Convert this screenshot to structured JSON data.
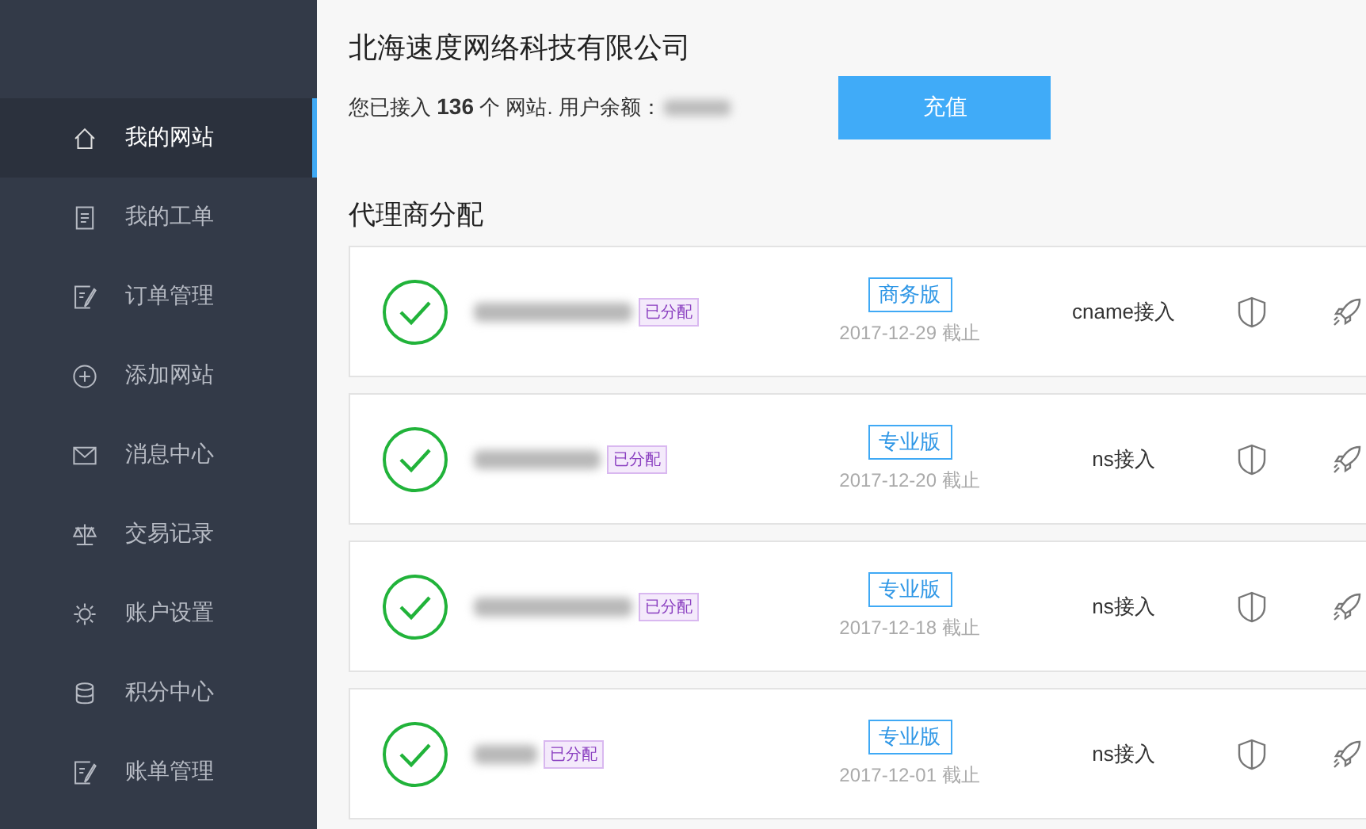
{
  "sidebar": {
    "items": [
      {
        "label": "我的网站",
        "kind": "home",
        "selected": true
      },
      {
        "label": "我的工单",
        "kind": "doc",
        "selected": false
      },
      {
        "label": "订单管理",
        "kind": "edit",
        "selected": false
      },
      {
        "label": "添加网站",
        "kind": "plus",
        "selected": false
      },
      {
        "label": "消息中心",
        "kind": "mail",
        "selected": false
      },
      {
        "label": "交易记录",
        "kind": "scale",
        "selected": false
      },
      {
        "label": "账户设置",
        "kind": "gear",
        "selected": false
      },
      {
        "label": "积分中心",
        "kind": "db",
        "selected": false
      },
      {
        "label": "账单管理",
        "kind": "edit",
        "selected": false
      }
    ]
  },
  "header": {
    "company": "北海速度网络科技有限公司",
    "summary": "您已接入 **136** 个 网站. 用户余额：",
    "recharge_button": "充值"
  },
  "section_title": "代理商分配",
  "sites": [
    {
      "tag": "已分配",
      "edition": "商务版",
      "expires": "2017-12-29 截止",
      "access": "cname接入"
    },
    {
      "tag": "已分配",
      "edition": "专业版",
      "expires": "2017-12-20 截止",
      "access": "ns接入"
    },
    {
      "tag": "已分配",
      "edition": "专业版",
      "expires": "2017-12-18 截止",
      "access": "ns接入"
    },
    {
      "tag": "已分配",
      "edition": "专业版",
      "expires": "2017-12-01 截止",
      "access": "ns接入"
    }
  ]
}
